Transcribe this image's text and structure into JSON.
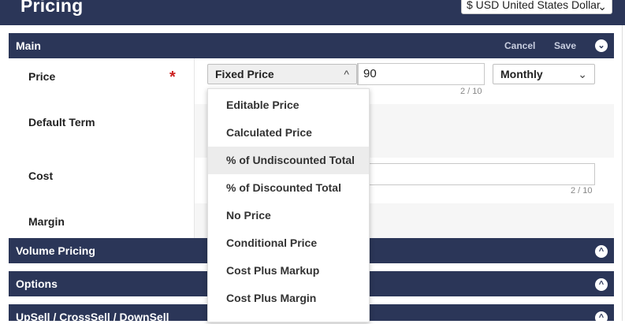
{
  "header": {
    "title": "Pricing",
    "currency_label": "$ USD United States Dollar"
  },
  "main": {
    "section_label": "Main",
    "cancel_label": "Cancel",
    "save_label": "Save",
    "fields": {
      "price": "Price",
      "default_term": "Default Term",
      "cost": "Cost",
      "margin": "Margin"
    },
    "price_type": "Fixed Price",
    "price_value": "90",
    "price_counter": "2 / 10",
    "term_value": "Monthly",
    "cost_counter": "2 / 10"
  },
  "dropdown": {
    "options": [
      "Editable Price",
      "Calculated Price",
      "% of Undiscounted Total",
      "% of Discounted Total",
      "No Price",
      "Conditional Price",
      "Cost Plus Markup",
      "Cost Plus Margin"
    ],
    "highlighted": "% of Undiscounted Total"
  },
  "sections": {
    "volume_pricing": "Volume Pricing",
    "options": "Options",
    "upsell": "UpSell / CrossSell / DownSell"
  },
  "icons": {
    "collapse": "chevron-up-circle-icon",
    "expand": "chevron-down-circle-icon"
  },
  "colors": {
    "header_bg": "#2b3658",
    "required": "#cc1f1f"
  }
}
